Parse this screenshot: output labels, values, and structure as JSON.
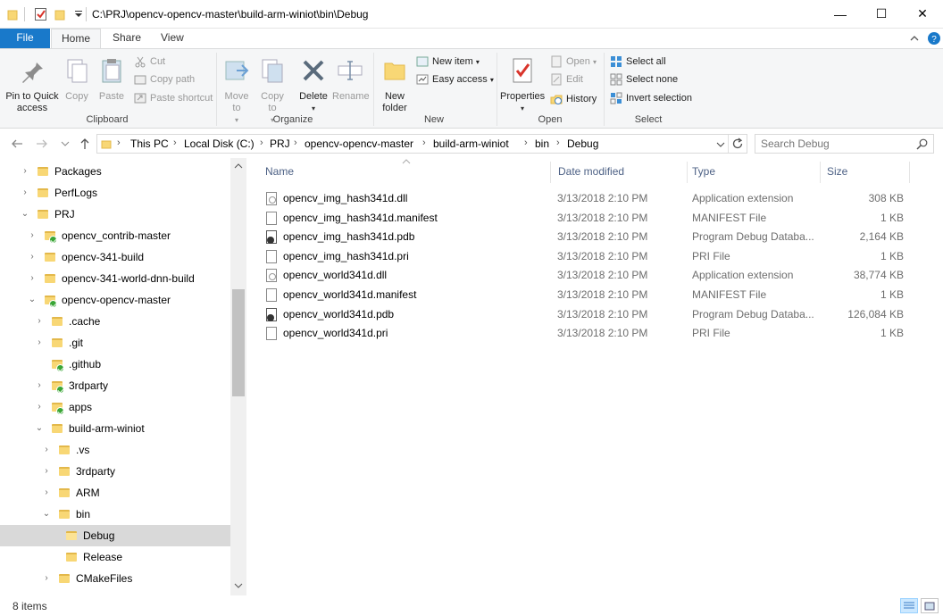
{
  "window": {
    "title": "C:\\PRJ\\opencv-opencv-master\\build-arm-winiot\\bin\\Debug",
    "minimize_glyph": "—",
    "maximize_glyph": "☐",
    "close_glyph": "✕"
  },
  "tabs": [
    {
      "label": "File"
    },
    {
      "label": "Home"
    },
    {
      "label": "Share"
    },
    {
      "label": "View"
    }
  ],
  "ribbon": {
    "clipboard": {
      "label": "Clipboard",
      "pin": "Pin to Quick access",
      "copy": "Copy",
      "paste": "Paste",
      "cut": "Cut",
      "copy_path": "Copy path",
      "paste_shortcut": "Paste shortcut"
    },
    "organize": {
      "label": "Organize",
      "move_to": "Move to",
      "copy_to": "Copy to",
      "delete": "Delete",
      "rename": "Rename"
    },
    "new": {
      "label": "New",
      "new_folder": "New folder",
      "new_item": "New item",
      "easy_access": "Easy access"
    },
    "open": {
      "label": "Open",
      "properties": "Properties",
      "open": "Open",
      "edit": "Edit",
      "history": "History"
    },
    "select": {
      "label": "Select",
      "select_all": "Select all",
      "select_none": "Select none",
      "invert": "Invert selection"
    }
  },
  "address": {
    "crumbs": [
      "This PC",
      "Local Disk (C:)",
      "PRJ",
      "opencv-opencv-master",
      "build-arm-winiot",
      "bin",
      "Debug"
    ],
    "search_placeholder": "Search Debug"
  },
  "tree": [
    {
      "label": "Packages",
      "chev": "›",
      "badge": false
    },
    {
      "label": "PerfLogs",
      "chev": "›",
      "badge": false
    },
    {
      "label": "PRJ",
      "chev": "⌄",
      "badge": false
    },
    {
      "label": "opencv_contrib-master",
      "chev": "›",
      "badge": true
    },
    {
      "label": "opencv-341-build",
      "chev": "›",
      "badge": false
    },
    {
      "label": "opencv-341-world-dnn-build",
      "chev": "›",
      "badge": false
    },
    {
      "label": "opencv-opencv-master",
      "chev": "⌄",
      "badge": true
    },
    {
      "label": ".cache",
      "chev": "›",
      "badge": false
    },
    {
      "label": ".git",
      "chev": "›",
      "badge": false
    },
    {
      "label": ".github",
      "chev": "",
      "badge": true
    },
    {
      "label": "3rdparty",
      "chev": "›",
      "badge": true
    },
    {
      "label": "apps",
      "chev": "›",
      "badge": true
    },
    {
      "label": "build-arm-winiot",
      "chev": "⌄",
      "badge": false
    },
    {
      "label": ".vs",
      "chev": "›",
      "badge": false
    },
    {
      "label": "3rdparty",
      "chev": "›",
      "badge": false
    },
    {
      "label": "ARM",
      "chev": "›",
      "badge": false
    },
    {
      "label": "bin",
      "chev": "⌄",
      "badge": false
    },
    {
      "label": "Debug",
      "chev": "",
      "badge": false
    },
    {
      "label": "Release",
      "chev": "",
      "badge": false
    },
    {
      "label": "CMakeFiles",
      "chev": "›",
      "badge": false
    }
  ],
  "columns": {
    "name": "Name",
    "date": "Date modified",
    "type": "Type",
    "size": "Size"
  },
  "files": [
    {
      "name": "opencv_img_hash341d.dll",
      "date": "3/13/2018 2:10 PM",
      "type": "Application extension",
      "size": "308 KB",
      "icon": "dll"
    },
    {
      "name": "opencv_img_hash341d.manifest",
      "date": "3/13/2018 2:10 PM",
      "type": "MANIFEST File",
      "size": "1 KB",
      "icon": "doc"
    },
    {
      "name": "opencv_img_hash341d.pdb",
      "date": "3/13/2018 2:10 PM",
      "type": "Program Debug Databa...",
      "size": "2,164 KB",
      "icon": "pdb"
    },
    {
      "name": "opencv_img_hash341d.pri",
      "date": "3/13/2018 2:10 PM",
      "type": "PRI File",
      "size": "1 KB",
      "icon": "doc"
    },
    {
      "name": "opencv_world341d.dll",
      "date": "3/13/2018 2:10 PM",
      "type": "Application extension",
      "size": "38,774 KB",
      "icon": "dll"
    },
    {
      "name": "opencv_world341d.manifest",
      "date": "3/13/2018 2:10 PM",
      "type": "MANIFEST File",
      "size": "1 KB",
      "icon": "doc"
    },
    {
      "name": "opencv_world341d.pdb",
      "date": "3/13/2018 2:10 PM",
      "type": "Program Debug Databa...",
      "size": "126,084 KB",
      "icon": "pdb"
    },
    {
      "name": "opencv_world341d.pri",
      "date": "3/13/2018 2:10 PM",
      "type": "PRI File",
      "size": "1 KB",
      "icon": "doc"
    }
  ],
  "status": {
    "count": "8 items"
  },
  "colors": {
    "accent": "#1979ca",
    "selected": "#d9d9d9",
    "folder": "#f8d775"
  }
}
